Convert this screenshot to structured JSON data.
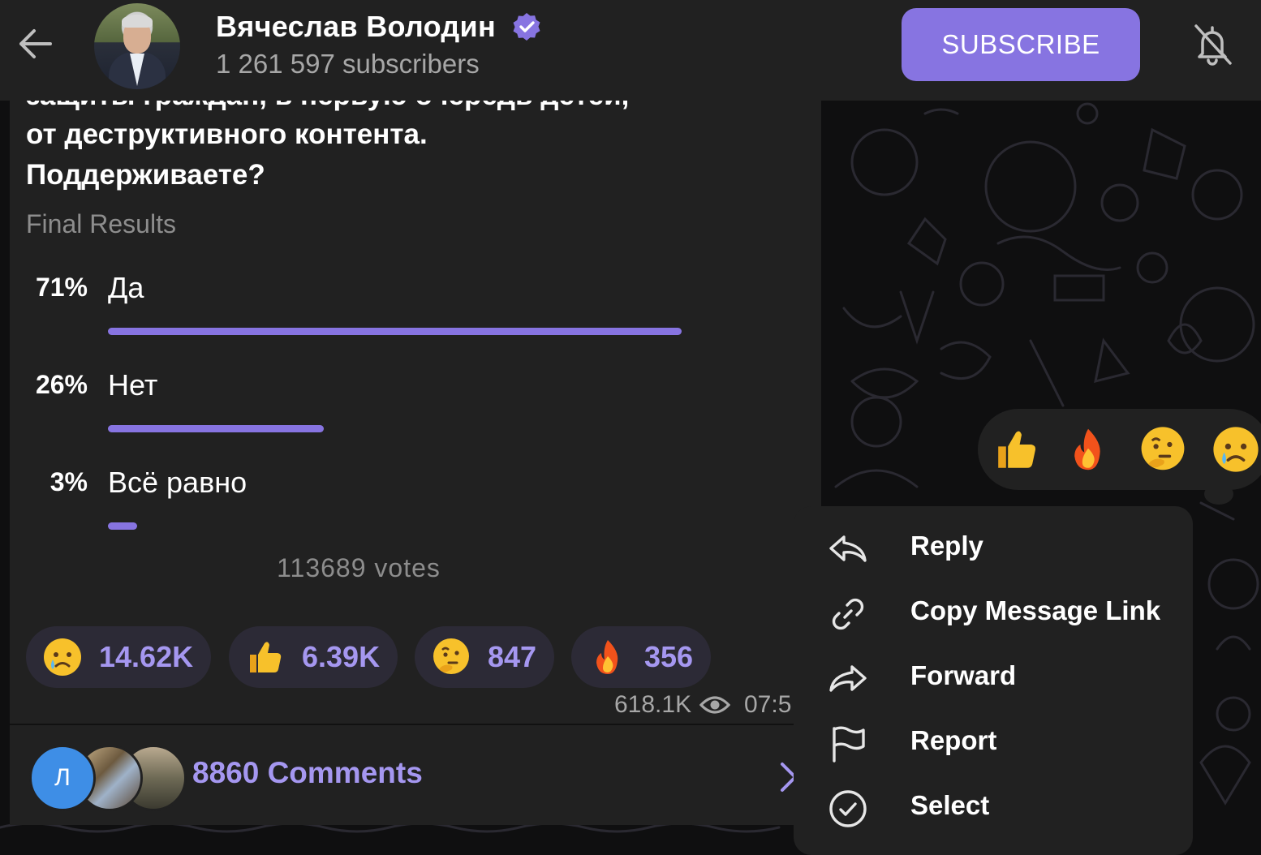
{
  "header": {
    "channel_name": "Вячеслав Володин",
    "subscribers": "1 261 597 subscribers",
    "subscribe_label": "SUBSCRIBE"
  },
  "message": {
    "question_cut_line": "защиты граждан, в первую очередь детей,",
    "question_line_2": "от деструктивного контента.",
    "question_line_3": "Поддерживаете?",
    "final_results": "Final Results",
    "options": [
      {
        "percent": "71%",
        "label": "Да",
        "value": 71
      },
      {
        "percent": "26%",
        "label": "Нет",
        "value": 26
      },
      {
        "percent": "3%",
        "label": "Всё равно",
        "value": 3
      }
    ],
    "votes": "113689 votes",
    "reactions": [
      {
        "emoji": "crying-face",
        "count": "14.62K"
      },
      {
        "emoji": "thumbs-up",
        "count": "6.39K"
      },
      {
        "emoji": "thinking-face",
        "count": "847"
      },
      {
        "emoji": "fire",
        "count": "356"
      }
    ],
    "views": "618.1K",
    "time": "07:5",
    "comments_label": "8860 Comments",
    "comment_avatar_letter": "Л"
  },
  "quick_reactions": [
    "thumbs-up",
    "fire",
    "thinking-face",
    "crying-face"
  ],
  "context_menu": {
    "items": [
      {
        "label": "Reply",
        "icon": "reply-icon"
      },
      {
        "label": "Copy Message Link",
        "icon": "link-icon"
      },
      {
        "label": "Forward",
        "icon": "forward-icon"
      },
      {
        "label": "Report",
        "icon": "flag-icon"
      },
      {
        "label": "Select",
        "icon": "check-circle-icon"
      }
    ]
  },
  "colors": {
    "accent": "#8774e1",
    "accent_text": "#a597f0",
    "surface": "#212121",
    "background": "#0f0f10"
  }
}
